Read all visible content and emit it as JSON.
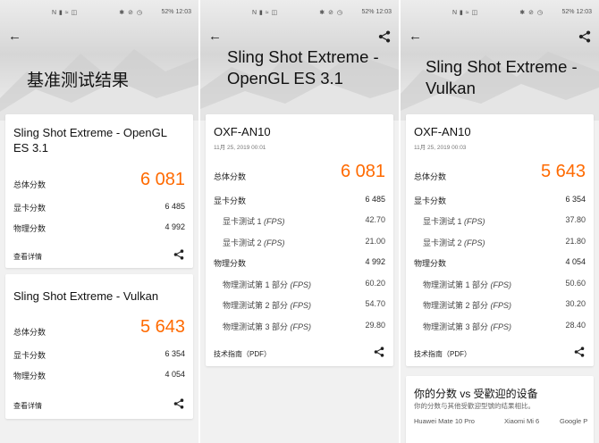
{
  "status_bar": {
    "left_icons": "N ▮ ≈ ◫",
    "right_icons": "✱ ⊘ ◷",
    "battery": "52%",
    "time": "12:03"
  },
  "screen1": {
    "title": "基准测试结果",
    "card_opengl": {
      "title": "Sling Shot Extreme - OpenGL ES 3.1",
      "total_label": "总体分数",
      "total_value": "6 081",
      "gpu_label": "显卡分数",
      "gpu_value": "6 485",
      "physics_label": "物理分数",
      "physics_value": "4 992",
      "details_link": "查看详情"
    },
    "card_vulkan": {
      "title": "Sling Shot Extreme - Vulkan",
      "total_label": "总体分数",
      "total_value": "5 643",
      "gpu_label": "显卡分数",
      "gpu_value": "6 354",
      "physics_label": "物理分数",
      "physics_value": "4 054",
      "details_link": "查看详情"
    }
  },
  "screen2": {
    "title": "Sling Shot Extreme - OpenGL ES 3.1",
    "device": "OXF-AN10",
    "date": "11月 25, 2019 00:01",
    "total_label": "总体分数",
    "total_value": "6 081",
    "gpu_label": "显卡分数",
    "gpu_value": "6 485",
    "gt1_label": "显卡测试 1",
    "gt1_value": "42.70",
    "gt2_label": "显卡测试 2",
    "gt2_value": "21.00",
    "physics_label": "物理分数",
    "physics_value": "4 992",
    "pt1_label": "物理测试第 1 部分",
    "pt1_value": "60.20",
    "pt2_label": "物理测试第 2 部分",
    "pt2_value": "54.70",
    "pt3_label": "物理测试第 3 部分",
    "pt3_value": "29.80",
    "fps_unit": "(FPS)",
    "guide_link": "技术指南（PDF）"
  },
  "screen3": {
    "title": "Sling Shot Extreme - Vulkan",
    "device": "OXF-AN10",
    "date": "11月 25, 2019 00:03",
    "total_label": "总体分数",
    "total_value": "5 643",
    "gpu_label": "显卡分数",
    "gpu_value": "6 354",
    "gt1_label": "显卡测试 1",
    "gt1_value": "37.80",
    "gt2_label": "显卡测试 2",
    "gt2_value": "21.80",
    "physics_label": "物理分数",
    "physics_value": "4 054",
    "pt1_label": "物理测试第 1 部分",
    "pt1_value": "50.60",
    "pt2_label": "物理测试第 2 部分",
    "pt2_value": "30.20",
    "pt3_label": "物理测试第 3 部分",
    "pt3_value": "28.40",
    "fps_unit": "(FPS)",
    "guide_link": "技术指南（PDF）",
    "compare": {
      "title": "你的分数 vs 受歡迎的设备",
      "desc": "你的分数与其他受歡迎型號的结果相比。",
      "devices": [
        "Huawei Mate 10 Pro",
        "Xiaomi Mi 6",
        "Google P"
      ]
    }
  },
  "colors": {
    "accent_orange": "#ff6a00",
    "background": "#f1f1f1",
    "card": "#ffffff"
  },
  "icons": [
    "back-arrow-icon",
    "share-icon"
  ]
}
